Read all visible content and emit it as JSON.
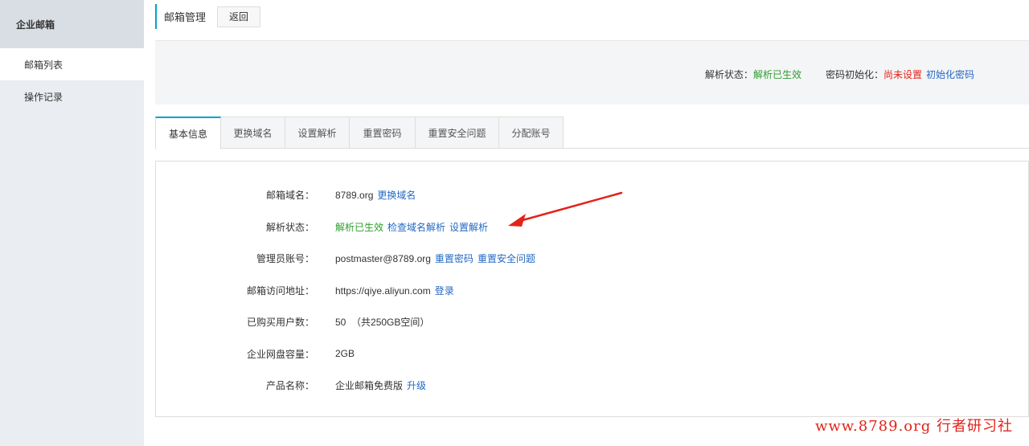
{
  "sidebar": {
    "title": "企业邮箱",
    "items": [
      {
        "label": "邮箱列表",
        "active": true
      },
      {
        "label": "操作记录",
        "active": false
      }
    ]
  },
  "topbar": {
    "title": "邮箱管理",
    "back_label": "返回"
  },
  "status": {
    "resolve_label": "解析状态：",
    "resolve_value": "解析已生效",
    "pwd_label": "密码初始化：",
    "pwd_value": "尚未设置",
    "pwd_link": "初始化密码"
  },
  "tabs": [
    {
      "label": "基本信息",
      "active": true
    },
    {
      "label": "更换域名"
    },
    {
      "label": "设置解析"
    },
    {
      "label": "重置密码"
    },
    {
      "label": "重置安全问题"
    },
    {
      "label": "分配账号"
    }
  ],
  "info": {
    "domain": {
      "label": "邮箱域名：",
      "value": "8789.org",
      "link": "更换域名"
    },
    "resolve": {
      "label": "解析状态：",
      "value": "解析已生效",
      "link1": "检查域名解析",
      "link2": "设置解析"
    },
    "admin": {
      "label": "管理员账号：",
      "value": "postmaster@8789.org",
      "link1": "重置密码",
      "link2": "重置安全问题"
    },
    "url": {
      "label": "邮箱访问地址：",
      "value": "https://qiye.aliyun.com",
      "link": "登录"
    },
    "users": {
      "label": "已购买用户数：",
      "value": "50  （共250GB空间）"
    },
    "disk": {
      "label": "企业网盘容量：",
      "value": "2GB"
    },
    "product": {
      "label": "产品名称：",
      "value": "企业邮箱免费版",
      "link": "升级"
    }
  },
  "colors": {
    "accent": "#00a2ca",
    "link": "#2469c4",
    "success": "#2e9d2e",
    "warning": "#e2231a"
  },
  "watermark": "www.8789.org 行者研习社"
}
